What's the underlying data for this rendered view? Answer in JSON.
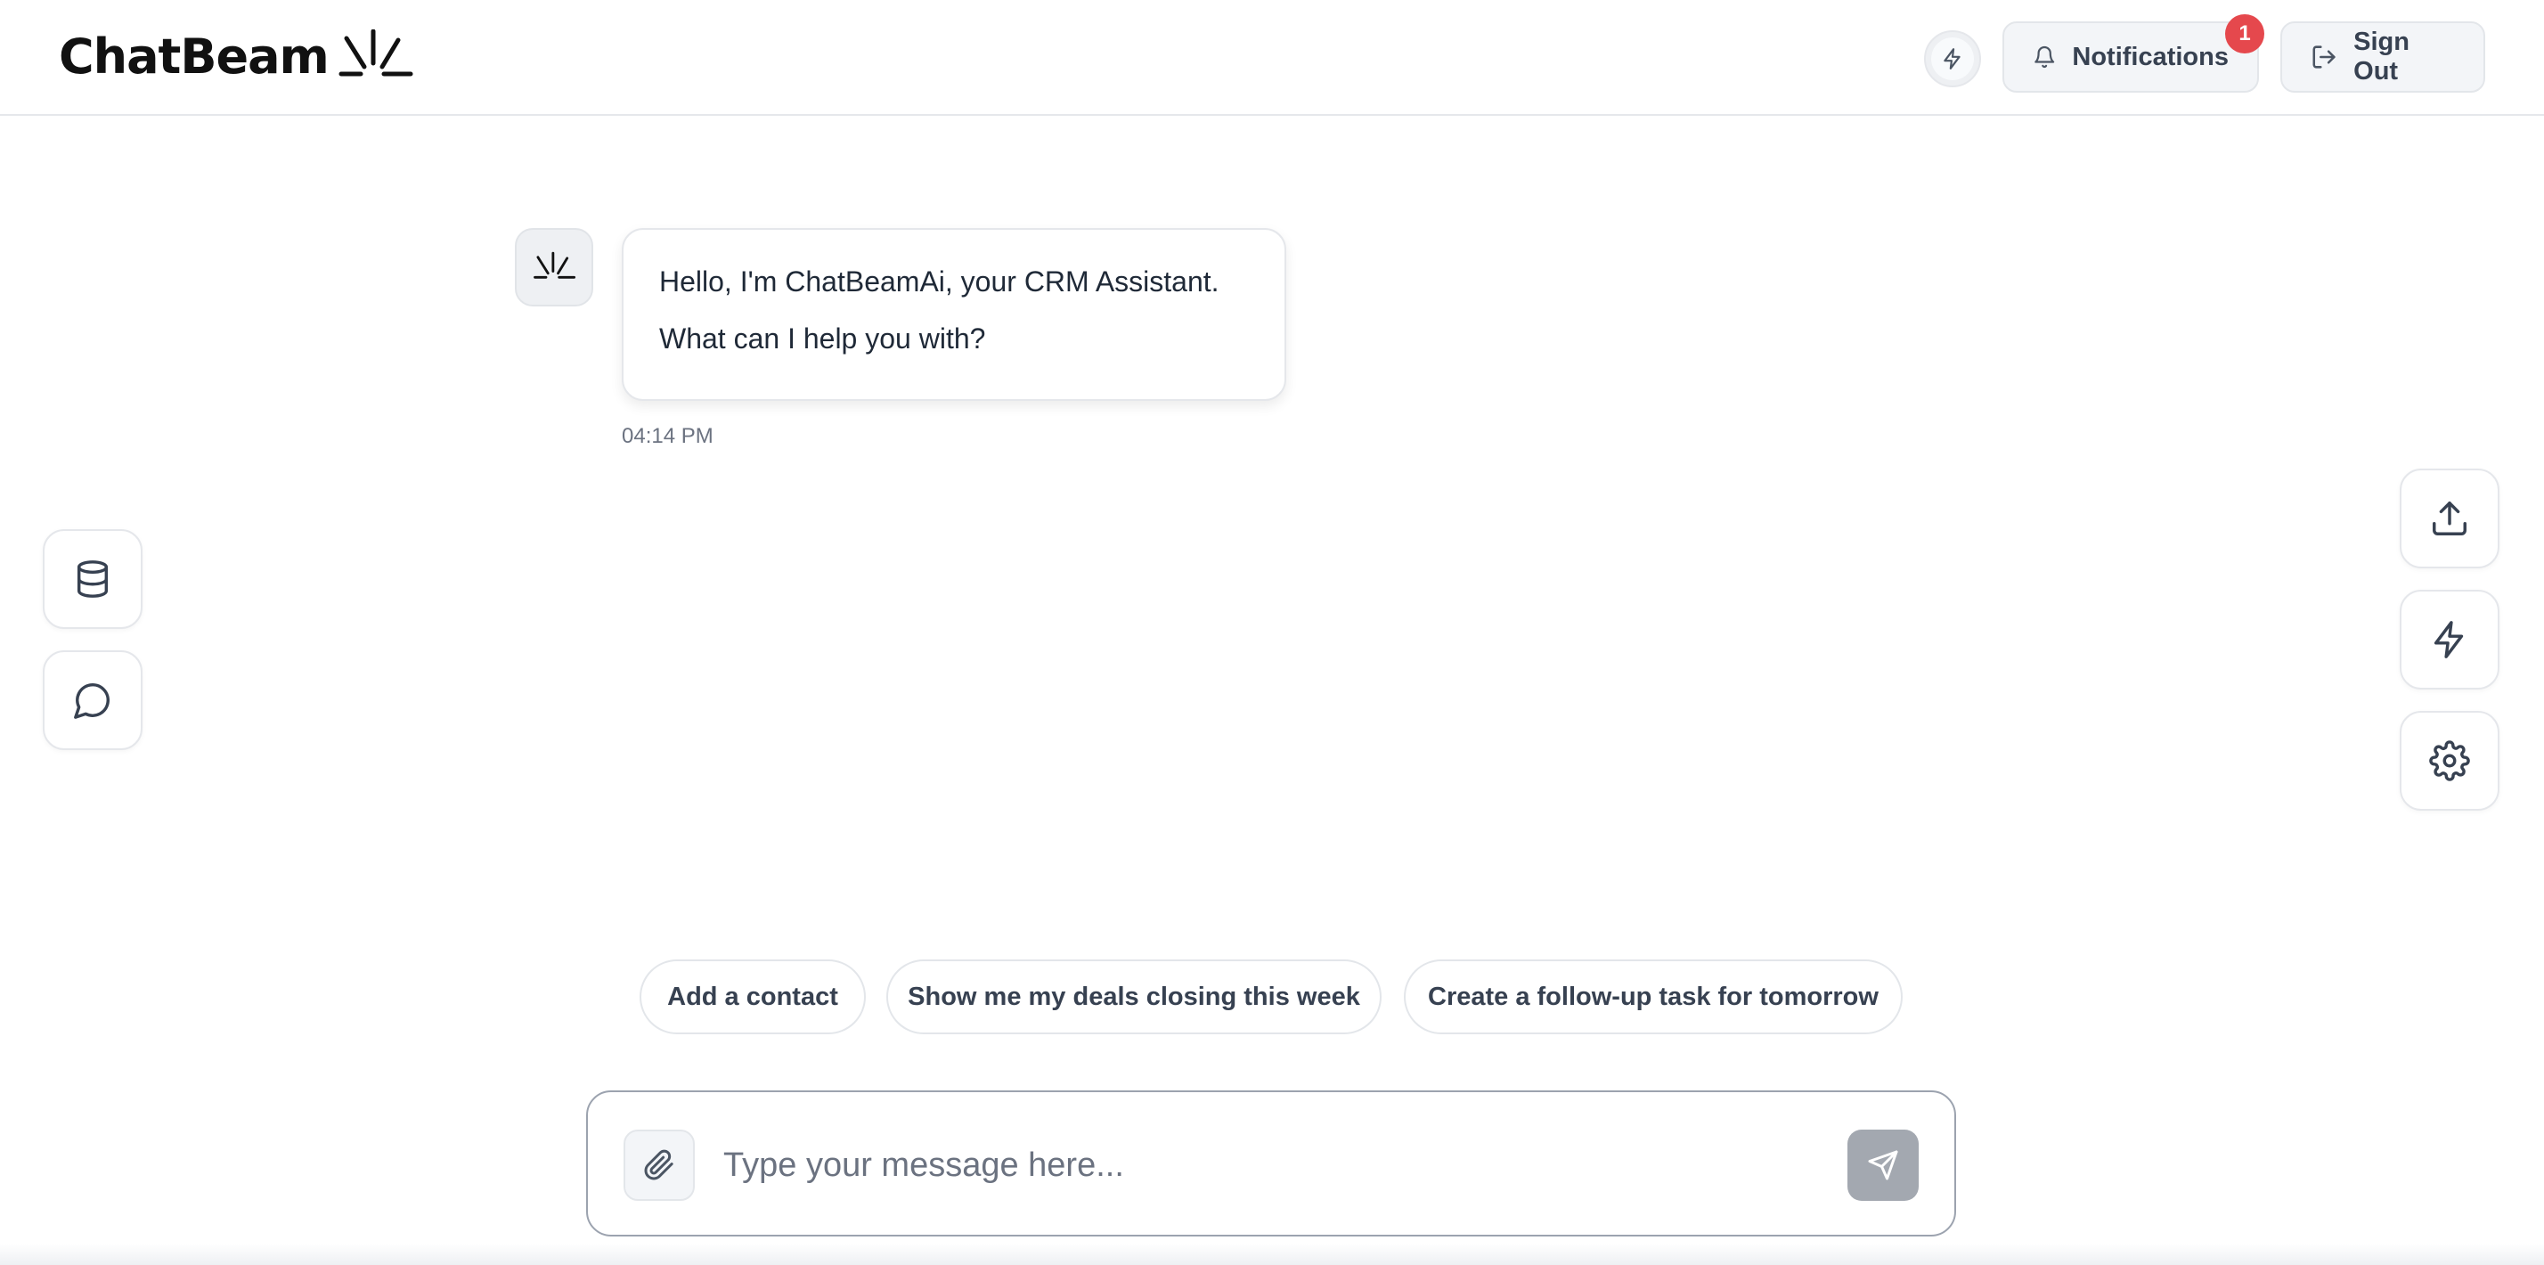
{
  "app": {
    "logo_text": "ChatBeam",
    "accent_color": "#e5484d"
  },
  "header": {
    "quick_action_icon": "lightning-icon",
    "notifications_label": "Notifications",
    "notifications_count": "1",
    "sign_out_label": "Sign Out"
  },
  "left_rail": [
    {
      "icon": "database-icon"
    },
    {
      "icon": "chat-bubble-icon"
    }
  ],
  "right_rail": [
    {
      "icon": "upload-icon"
    },
    {
      "icon": "lightning-icon"
    },
    {
      "icon": "gear-icon"
    }
  ],
  "conversation": {
    "messages": [
      {
        "sender": "bot",
        "lines": [
          "Hello, I'm ChatBeamAi, your CRM Assistant.",
          "What can I help you with?"
        ],
        "time": "04:14 PM"
      }
    ]
  },
  "suggestions": [
    {
      "label": "Add a contact"
    },
    {
      "label": "Show me my deals closing this week"
    },
    {
      "label": "Create a follow-up task for tomorrow"
    }
  ],
  "composer": {
    "value": "",
    "placeholder": "Type your message here..."
  }
}
